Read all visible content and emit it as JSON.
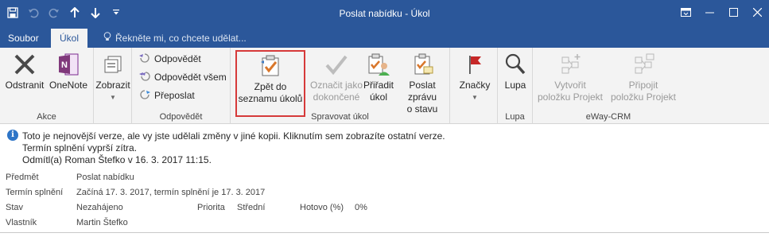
{
  "window": {
    "title": "Poslat nabídku - Úkol",
    "controls": [
      "restore-ribbon",
      "minimize",
      "maximize",
      "close"
    ]
  },
  "qat": {
    "icons": [
      "save-icon",
      "undo-icon",
      "redo-icon",
      "up-arrow-icon",
      "down-arrow-icon",
      "customize-icon"
    ]
  },
  "tabs": {
    "file": "Soubor",
    "active": "Úkol",
    "tell_me": "Řekněte mi, co chcete udělat..."
  },
  "ribbon": {
    "akce": {
      "label": "Akce",
      "delete": "Odstranit",
      "onenote": "OneNote"
    },
    "view": {
      "label": "Zobrazit"
    },
    "odpovedet": {
      "label": "Odpovědět",
      "reply": "Odpovědět",
      "reply_all": "Odpovědět všem",
      "forward": "Přeposlat"
    },
    "spravovat": {
      "label": "Spravovat úkol",
      "back_line1": "Zpět do",
      "back_line2": "seznamu úkolů",
      "mark_line1": "Označit jako",
      "mark_line2": "dokončené",
      "assign_line1": "Přiřadit",
      "assign_line2": "úkol",
      "status_line1": "Poslat zprávu",
      "status_line2": "o stavu"
    },
    "tags": {
      "label": "Značky"
    },
    "zoom": {
      "label": "Lupa",
      "button": "Lupa"
    },
    "eway": {
      "label": "eWay-CRM",
      "create_line1": "Vytvořit",
      "create_line2": "položku Projekt",
      "attach_line1": "Připojit",
      "attach_line2": "položku Projekt"
    }
  },
  "infobar": {
    "line1": "Toto je nejnovější verze, ale vy jste udělali změny v jiné kopii. Kliknutím sem zobrazíte ostatní verze.",
    "line2": "Termín splnění vyprší zítra.",
    "line3": "Odmítl(a) Roman Štefko v 16. 3. 2017 11:15."
  },
  "fields": {
    "subject_label": "Předmět",
    "subject_value": "Poslat nabídku",
    "due_label": "Termín splnění",
    "due_value": "Začíná 17. 3. 2017, termín splnění je 17. 3. 2017",
    "status_label": "Stav",
    "status_value": "Nezahájeno",
    "priority_label": "Priorita",
    "priority_value": "Střední",
    "done_label": "Hotovo (%)",
    "done_value": "0%",
    "owner_label": "Vlastník",
    "owner_value": "Martin Štefko"
  },
  "colors": {
    "brand": "#2b579a",
    "highlight": "#d63a3a",
    "info": "#2e75c7"
  }
}
